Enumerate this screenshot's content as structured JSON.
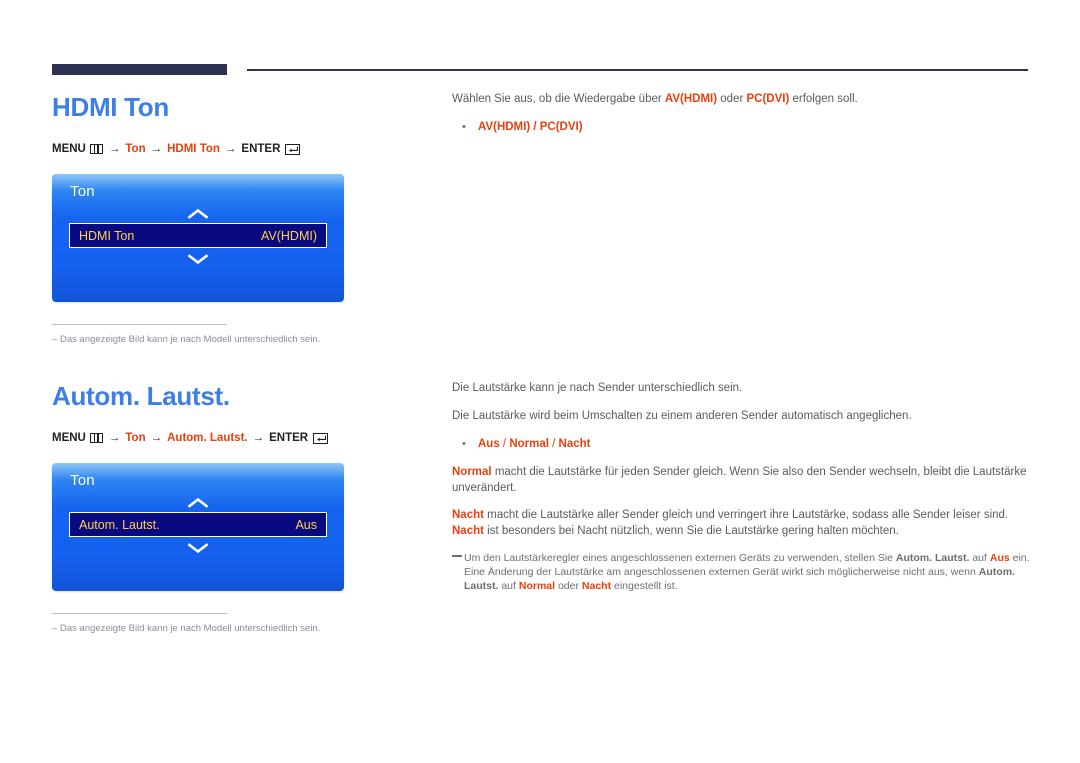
{
  "header": {
    "rule_color": "#2e3152"
  },
  "theme": {
    "title_blue": "#3d7fe4",
    "accent_orange": "#e8400c",
    "body_gray": "#5a5b5e",
    "osd_yellow": "#ffd24a",
    "osd_row_navy": "#0a0a80"
  },
  "sections": [
    {
      "id": "hdmi-ton",
      "title": "HDMI Ton",
      "menu_path": {
        "menu_label": "MENU",
        "menu_icon": "menu-grid-icon",
        "steps": [
          "Ton",
          "HDMI Ton"
        ],
        "enter_label": "ENTER",
        "enter_icon": "enter-return-icon",
        "arrow": "→"
      },
      "osd": {
        "title": "Ton",
        "up_icon": "chevron-up-icon",
        "down_icon": "chevron-down-icon",
        "row_label": "HDMI Ton",
        "row_value": "AV(HDMI)"
      },
      "note": {
        "dash": "–",
        "text": "Das angezeigte Bild kann je nach Modell unterschiedlich sein."
      },
      "right": {
        "intro_pre": "Wählen Sie aus, ob die Wiedergabe über ",
        "intro_accent1": "AV(HDMI)",
        "intro_mid": " oder ",
        "intro_accent2": "PC(DVI)",
        "intro_post": " erfolgen soll.",
        "bullet_dot": "•",
        "bullet_text": "AV(HDMI) / PC(DVI)"
      }
    },
    {
      "id": "autom-lautst",
      "title": "Autom. Lautst.",
      "menu_path": {
        "menu_label": "MENU",
        "menu_icon": "menu-grid-icon",
        "steps": [
          "Ton",
          "Autom. Lautst."
        ],
        "enter_label": "ENTER",
        "enter_icon": "enter-return-icon",
        "arrow": "→"
      },
      "osd": {
        "title": "Ton",
        "up_icon": "chevron-up-icon",
        "down_icon": "chevron-down-icon",
        "row_label": "Autom. Lautst.",
        "row_value": "Aus"
      },
      "note": {
        "dash": "–",
        "text": "Das angezeigte Bild kann je nach Modell unterschiedlich sein."
      },
      "right": {
        "line1": "Die Lautstärke kann je nach Sender unterschiedlich sein.",
        "line2": "Die Lautstärke wird beim Umschalten zu einem anderen Sender automatisch angeglichen.",
        "bullet_dot": "•",
        "bullet_opt1": "Aus",
        "bullet_sep1": " / ",
        "bullet_opt2": "Normal",
        "bullet_sep2": " / ",
        "bullet_opt3": "Nacht",
        "para1_accent": "Normal",
        "para1_text": " macht die Lautstärke für jeden Sender gleich. Wenn Sie also den Sender wechseln, bleibt die Lautstärke unverändert.",
        "para2_accent1": "Nacht",
        "para2_text1": " macht die Lautstärke aller Sender gleich und verringert ihre Lautstärke, sodass alle Sender leiser sind. ",
        "para2_accent2": "Nacht",
        "para2_text2": " ist besonders bei Nacht nützlich, wenn Sie die Lautstärke gering halten möchten.",
        "note_text1": "Um den Lautstärkeregler eines angeschlossenen externen Geräts zu verwenden, stellen Sie ",
        "note_bold1": "Autom. Lautst.",
        "note_text2": " auf ",
        "note_accent1": "Aus",
        "note_text3": " ein. Eine Änderung der Lautstärke am angeschlossenen externen Gerät wirkt sich möglicherweise nicht aus, wenn ",
        "note_bold2": "Autom. Lautst.",
        "note_text4": " auf ",
        "note_accent2": "Normal",
        "note_text5": " oder ",
        "note_accent3": "Nacht",
        "note_text6": " eingestellt ist."
      }
    }
  ]
}
